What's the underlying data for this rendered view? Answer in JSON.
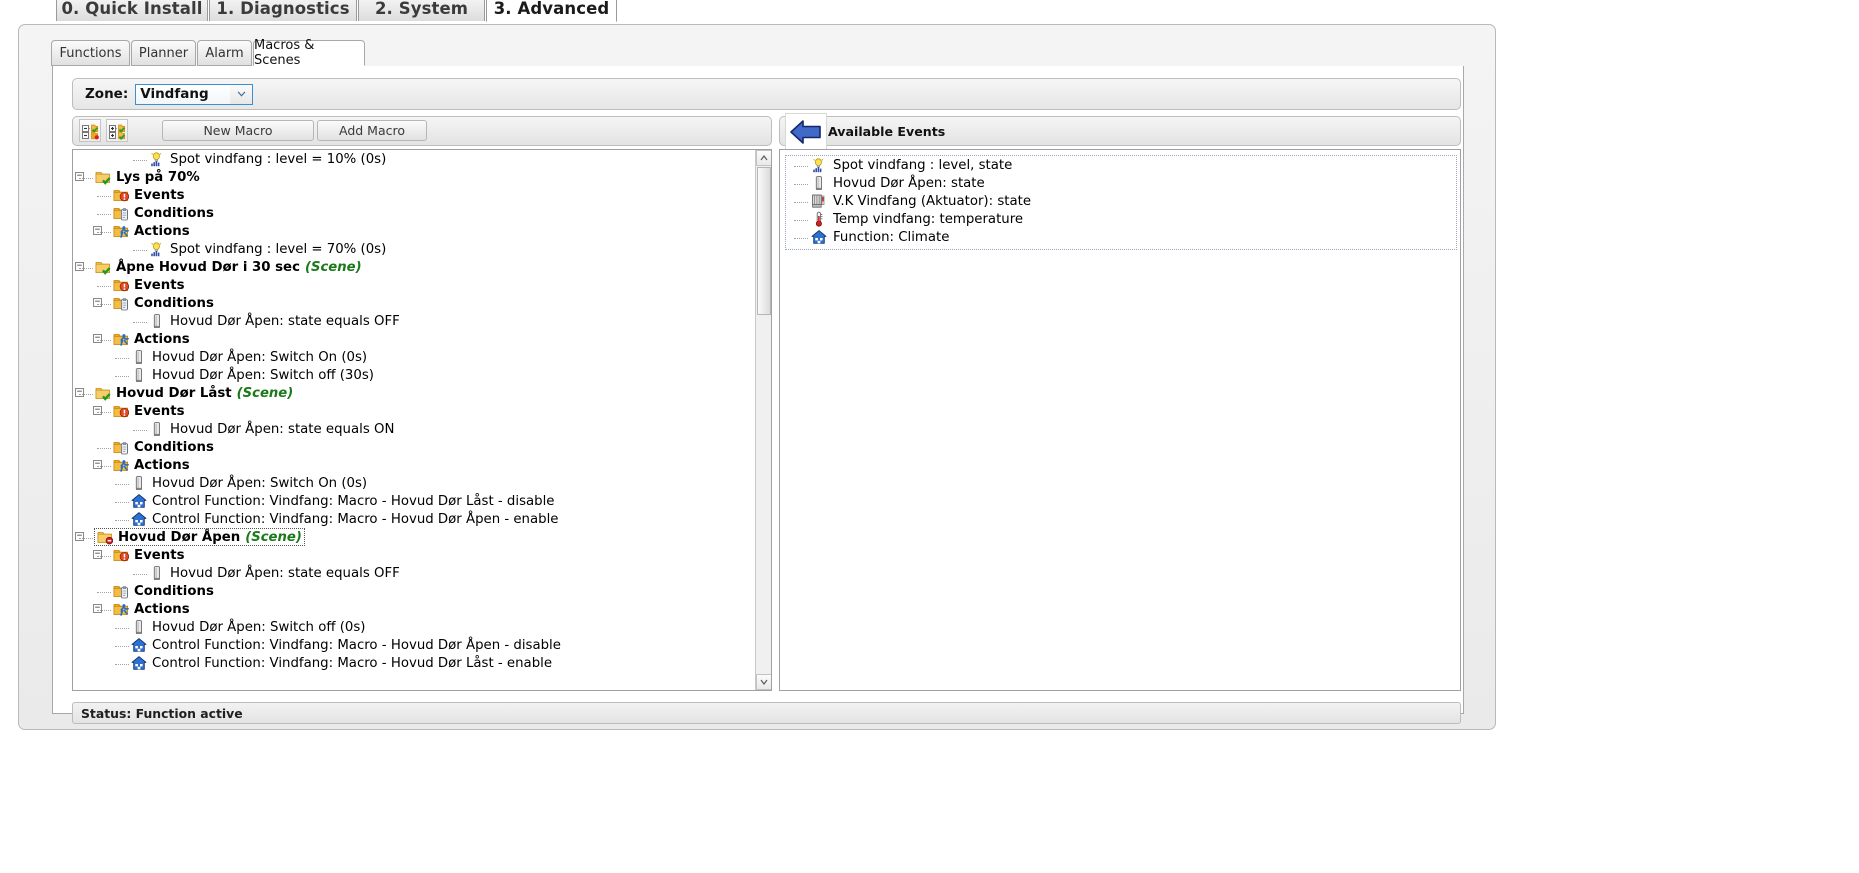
{
  "top_tabs": [
    {
      "label": "0. Quick Install",
      "active": false
    },
    {
      "label": "1. Diagnostics",
      "active": false
    },
    {
      "label": "2. System",
      "active": false
    },
    {
      "label": "3. Advanced",
      "active": true
    }
  ],
  "sub_tabs": [
    {
      "label": "Functions",
      "active": false
    },
    {
      "label": "Planner",
      "active": false
    },
    {
      "label": "Alarm",
      "active": false
    },
    {
      "label": "Macros & Scenes",
      "active": true
    }
  ],
  "zone": {
    "label": "Zone:",
    "value": "Vindfang",
    "options": [
      "Vindfang"
    ]
  },
  "toolbar": {
    "collapse_all_tooltip": "Collapse all",
    "expand_all_tooltip": "Expand all",
    "new_macro_label": "New Macro",
    "add_macro_label": "Add Macro"
  },
  "macro_tree": [
    {
      "indent": 3,
      "icon": "light-bulb-icon",
      "label": "Spot vindfang : level = 10% (0s)",
      "bold": false,
      "expander": "",
      "scene": "",
      "selected": false
    },
    {
      "indent": 0,
      "icon": "folder-check-icon",
      "label": "Lys på 70%",
      "bold": true,
      "expander": "minus",
      "scene": "",
      "selected": false
    },
    {
      "indent": 1,
      "icon": "folder-events-icon",
      "label": "Events",
      "bold": true,
      "expander": "",
      "scene": "",
      "selected": false
    },
    {
      "indent": 1,
      "icon": "folder-conditions-icon",
      "label": "Conditions",
      "bold": true,
      "expander": "",
      "scene": "",
      "selected": false
    },
    {
      "indent": 1,
      "icon": "folder-actions-icon",
      "label": "Actions",
      "bold": true,
      "expander": "minus",
      "scene": "",
      "selected": false
    },
    {
      "indent": 3,
      "icon": "light-bulb-icon",
      "label": "Spot vindfang : level = 70% (0s)",
      "bold": false,
      "expander": "",
      "scene": "",
      "selected": false
    },
    {
      "indent": 0,
      "icon": "folder-check-icon",
      "label": "Åpne Hovud Dør i 30 sec",
      "bold": true,
      "expander": "minus",
      "scene": "(Scene)",
      "selected": false
    },
    {
      "indent": 1,
      "icon": "folder-events-icon",
      "label": "Events",
      "bold": true,
      "expander": "",
      "scene": "",
      "selected": false
    },
    {
      "indent": 1,
      "icon": "folder-conditions-icon",
      "label": "Conditions",
      "bold": true,
      "expander": "minus",
      "scene": "",
      "selected": false
    },
    {
      "indent": 3,
      "icon": "door-sensor-icon",
      "label": "Hovud Dør Åpen: state equals OFF",
      "bold": false,
      "expander": "",
      "scene": "",
      "selected": false
    },
    {
      "indent": 1,
      "icon": "folder-actions-icon",
      "label": "Actions",
      "bold": true,
      "expander": "minus",
      "scene": "",
      "selected": false
    },
    {
      "indent": 2,
      "icon": "door-sensor-icon",
      "label": "Hovud Dør Åpen: Switch On (0s)",
      "bold": false,
      "expander": "",
      "scene": "",
      "selected": false
    },
    {
      "indent": 2,
      "icon": "door-sensor-icon",
      "label": "Hovud Dør Åpen: Switch off (30s)",
      "bold": false,
      "expander": "",
      "scene": "",
      "selected": false
    },
    {
      "indent": 0,
      "icon": "folder-check-icon",
      "label": "Hovud Dør Låst",
      "bold": true,
      "expander": "minus",
      "scene": "(Scene)",
      "selected": false
    },
    {
      "indent": 1,
      "icon": "folder-events-icon",
      "label": "Events",
      "bold": true,
      "expander": "minus",
      "scene": "",
      "selected": false
    },
    {
      "indent": 3,
      "icon": "door-sensor-icon",
      "label": "Hovud Dør Åpen: state equals ON",
      "bold": false,
      "expander": "",
      "scene": "",
      "selected": false
    },
    {
      "indent": 1,
      "icon": "folder-conditions-icon",
      "label": "Conditions",
      "bold": true,
      "expander": "",
      "scene": "",
      "selected": false
    },
    {
      "indent": 1,
      "icon": "folder-actions-icon",
      "label": "Actions",
      "bold": true,
      "expander": "minus",
      "scene": "",
      "selected": false
    },
    {
      "indent": 2,
      "icon": "door-sensor-icon",
      "label": "Hovud Dør Åpen: Switch On (0s)",
      "bold": false,
      "expander": "",
      "scene": "",
      "selected": false
    },
    {
      "indent": 2,
      "icon": "house-icon",
      "label": "Control Function: Vindfang: Macro - Hovud Dør Låst - disable",
      "bold": false,
      "expander": "",
      "scene": "",
      "selected": false
    },
    {
      "indent": 2,
      "icon": "house-icon",
      "label": "Control Function: Vindfang: Macro - Hovud Dør Åpen - enable",
      "bold": false,
      "expander": "",
      "scene": "",
      "selected": false
    },
    {
      "indent": 0,
      "icon": "folder-disabled-icon",
      "label": "Hovud Dør Åpen",
      "bold": true,
      "expander": "minus",
      "scene": "(Scene)",
      "selected": true
    },
    {
      "indent": 1,
      "icon": "folder-events-icon",
      "label": "Events",
      "bold": true,
      "expander": "minus",
      "scene": "",
      "selected": false
    },
    {
      "indent": 3,
      "icon": "door-sensor-icon",
      "label": "Hovud Dør Åpen: state equals OFF",
      "bold": false,
      "expander": "",
      "scene": "",
      "selected": false
    },
    {
      "indent": 1,
      "icon": "folder-conditions-icon",
      "label": "Conditions",
      "bold": true,
      "expander": "",
      "scene": "",
      "selected": false
    },
    {
      "indent": 1,
      "icon": "folder-actions-icon",
      "label": "Actions",
      "bold": true,
      "expander": "minus",
      "scene": "",
      "selected": false
    },
    {
      "indent": 2,
      "icon": "door-sensor-icon",
      "label": "Hovud Dør Åpen: Switch off (0s)",
      "bold": false,
      "expander": "",
      "scene": "",
      "selected": false
    },
    {
      "indent": 2,
      "icon": "house-icon",
      "label": "Control Function: Vindfang: Macro - Hovud Dør Åpen - disable",
      "bold": false,
      "expander": "",
      "scene": "",
      "selected": false
    },
    {
      "indent": 2,
      "icon": "house-icon",
      "label": "Control Function: Vindfang: Macro - Hovud Dør Låst - enable",
      "bold": false,
      "expander": "",
      "scene": "",
      "selected": false
    }
  ],
  "available_events": {
    "title": "Available Events",
    "back_arrow": "left-arrow-icon",
    "items": [
      {
        "icon": "light-bulb-icon",
        "label": "Spot vindfang : level, state"
      },
      {
        "icon": "door-sensor-icon",
        "label": "Hovud Dør Åpen: state"
      },
      {
        "icon": "actuator-icon",
        "label": "V.K Vindfang (Aktuator): state"
      },
      {
        "icon": "thermometer-icon",
        "label": "Temp vindfang: temperature"
      },
      {
        "icon": "house-icon",
        "label": "Function: Climate"
      }
    ]
  },
  "status": {
    "text": "Status: Function active"
  },
  "colors": {
    "accent_blue": "#3d8fd0",
    "scene_green": "#1a7a1a",
    "folder_orange": "#f0a818",
    "arrow_blue": "#4169c8"
  }
}
